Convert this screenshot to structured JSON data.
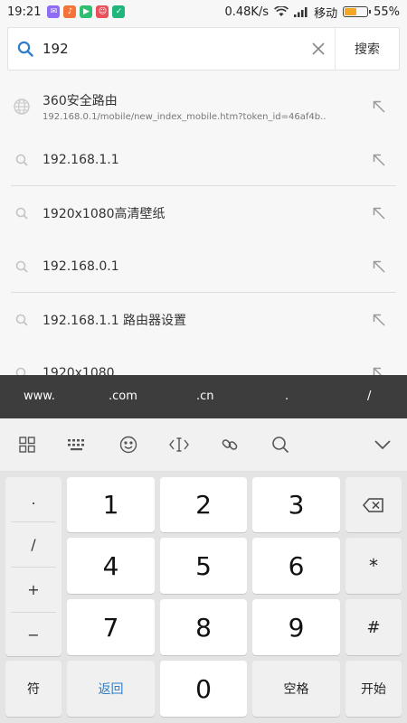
{
  "status_bar": {
    "time": "19:21",
    "speed": "0.48K/s",
    "carrier": "移动",
    "battery": "55%",
    "battery_level": 0.55
  },
  "search": {
    "query": "192",
    "button_label": "搜索"
  },
  "suggestions": [
    {
      "title": "360安全路由",
      "subtitle": "192.168.0.1/mobile/new_index_mobile.htm?token_id=46af4b..",
      "icon": "globe-icon"
    },
    {
      "title": "192.168.1.1",
      "icon": "search-icon"
    },
    {
      "title": "1920x1080高清壁纸",
      "icon": "search-icon"
    },
    {
      "title": "192.168.0.1",
      "icon": "search-icon"
    },
    {
      "title": "192.168.1.1 路由器设置",
      "icon": "search-icon"
    },
    {
      "title": "1920x1080",
      "icon": "search-icon"
    }
  ],
  "url_shortcuts": [
    "www.",
    ".com",
    ".cn",
    ".",
    "/"
  ],
  "keyboard": {
    "side_symbols": [
      ".",
      "/",
      "+",
      "−"
    ],
    "digits": [
      "1",
      "2",
      "3",
      "4",
      "5",
      "6",
      "7",
      "8",
      "9",
      "0"
    ],
    "star": "*",
    "hash": "#",
    "symbols_label": "符",
    "back_label": "返回",
    "space_label": "空格",
    "start_label": "开始"
  },
  "colors": {
    "accent": "#2f7dc8",
    "battery": "#f5a623",
    "url_bar": "#3d3d3d"
  }
}
